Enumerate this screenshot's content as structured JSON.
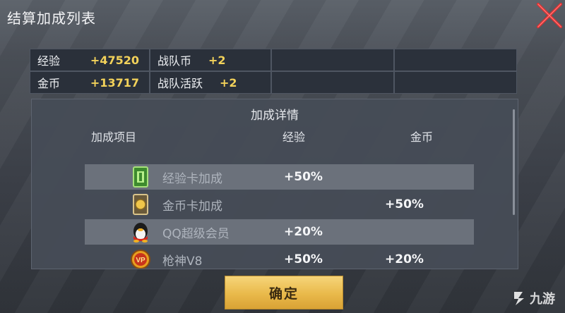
{
  "window": {
    "title": "结算加成列表"
  },
  "summary": [
    {
      "label": "经验",
      "value": "+47520"
    },
    {
      "label": "战队币",
      "value": "+2"
    },
    {
      "label": "金币",
      "value": "+13717"
    },
    {
      "label": "战队活跃",
      "value": "+2"
    }
  ],
  "details": {
    "heading": "加成详情",
    "columns": {
      "item": "加成项目",
      "exp": "经验",
      "gold": "金币"
    },
    "rows": [
      {
        "name": "经验卡加成",
        "exp": "+50%",
        "gold": "",
        "icon": "exp-card-icon"
      },
      {
        "name": "金币卡加成",
        "exp": "",
        "gold": "+50%",
        "icon": "gold-card-icon"
      },
      {
        "name": "QQ超级会员",
        "exp": "+20%",
        "gold": "",
        "icon": "qq-penguin-icon"
      },
      {
        "name": "枪神V8",
        "exp": "+50%",
        "gold": "+20%",
        "icon": "vip-badge-icon"
      }
    ]
  },
  "confirm_label": "确定",
  "watermark": "九游",
  "colors": {
    "accent_gold": "#f3d25a",
    "button_gold": "#e9b94a",
    "close_red": "#e03030"
  }
}
